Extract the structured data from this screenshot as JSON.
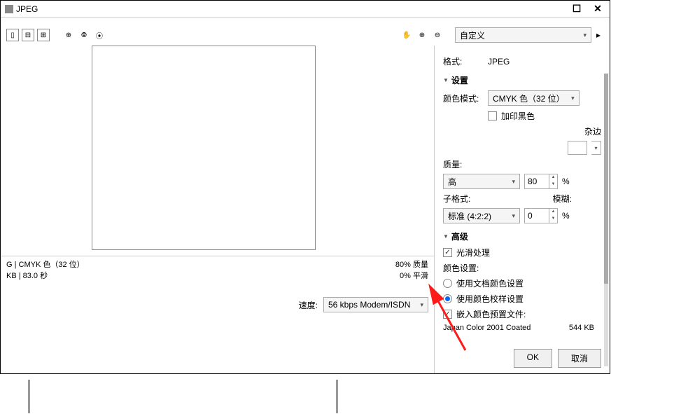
{
  "title": "JPEG",
  "toolbar": {
    "preset": "自定义"
  },
  "preview": {
    "info1": "G  |  CMYK 色（32 位）",
    "info2": "KB  |  83.0 秒",
    "quality_line": "80% 质量",
    "smooth_line": "0% 平滑",
    "speed_label": "速度:",
    "speed_value": "56 kbps Modem/ISDN"
  },
  "panel": {
    "format_label": "格式:",
    "format_value": "JPEG",
    "settings_head": "设置",
    "color_mode_label": "颜色模式:",
    "color_mode_value": "CMYK 色（32 位）",
    "overprint_black": "加印黑色",
    "matte_label": "杂边",
    "quality_label": "质量:",
    "quality_value": "高",
    "quality_num": "80",
    "subformat_label": "子格式:",
    "subformat_value": "标准 (4:2:2)",
    "blur_label": "模糊:",
    "blur_value": "0",
    "advanced_head": "高级",
    "smoothing": "光滑处理",
    "color_settings_label": "颜色设置:",
    "radio_doc": "使用文档颜色设置",
    "radio_proof": "使用颜色校样设置",
    "embed_profile": "嵌入颜色预置文件:",
    "profile_name": "Japan Color 2001 Coated",
    "profile_size": "544 KB",
    "ok": "OK",
    "cancel": "取消"
  },
  "percent": "%"
}
